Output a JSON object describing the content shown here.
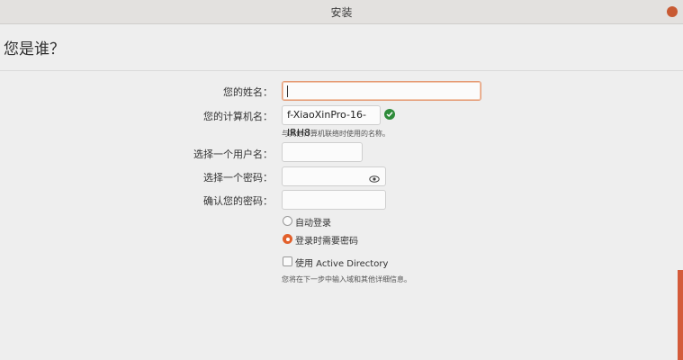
{
  "window": {
    "title": "安装"
  },
  "page": {
    "heading": "您是谁？"
  },
  "form": {
    "name_label": "您的姓名：",
    "name_value": "",
    "computer_label": "您的计算机名：",
    "computer_value": "f-XiaoXinPro-16-IRH8",
    "computer_hint": "与其他计算机联络时使用的名称。",
    "username_label": "选择一个用户名：",
    "username_value": "",
    "password_label": "选择一个密码：",
    "password_value": "",
    "confirm_label": "确认您的密码：",
    "confirm_value": "",
    "login_options": [
      {
        "label": "自动登录",
        "selected": false
      },
      {
        "label": "登录时需要密码",
        "selected": true
      }
    ],
    "ad_label": "使用 Active Directory",
    "ad_checked": false,
    "ad_hint": "您将在下一步中输入域和其他详细信息。"
  },
  "colors": {
    "accent": "#e2602b",
    "ok": "#2e8b3a"
  },
  "icons": {
    "computer_status": "checkmark-icon",
    "password_toggle": "eye-icon"
  }
}
